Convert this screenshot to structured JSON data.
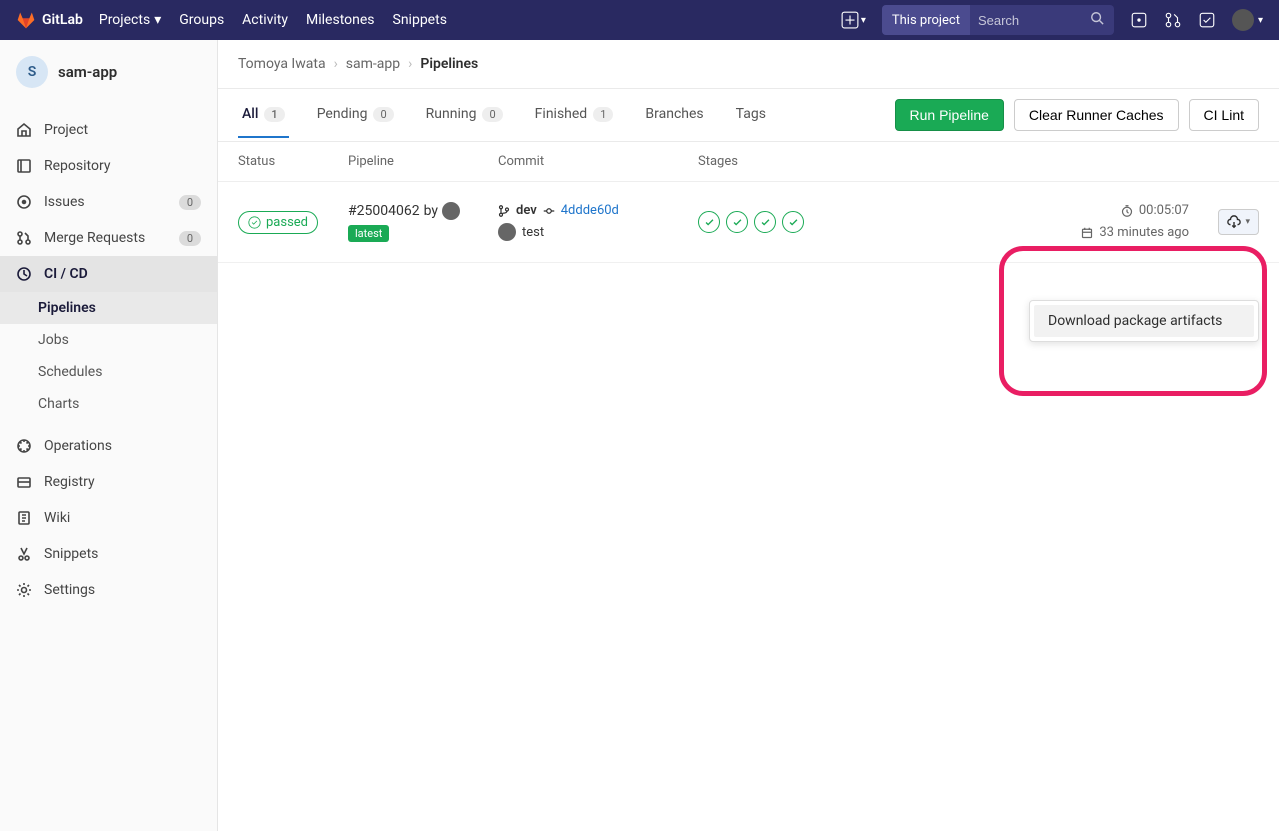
{
  "navbar": {
    "brand": "GitLab",
    "links": [
      "Projects",
      "Groups",
      "Activity",
      "Milestones",
      "Snippets"
    ],
    "search_scope": "This project",
    "search_placeholder": "Search"
  },
  "sidebar": {
    "project_initial": "S",
    "project_name": "sam-app",
    "items": [
      {
        "icon": "home",
        "label": "Project"
      },
      {
        "icon": "repo",
        "label": "Repository"
      },
      {
        "icon": "issues",
        "label": "Issues",
        "count": "0"
      },
      {
        "icon": "merge",
        "label": "Merge Requests",
        "count": "0"
      },
      {
        "icon": "cicd",
        "label": "CI / CD",
        "active": true,
        "sub": [
          {
            "label": "Pipelines",
            "active": true
          },
          {
            "label": "Jobs"
          },
          {
            "label": "Schedules"
          },
          {
            "label": "Charts"
          }
        ]
      },
      {
        "icon": "ops",
        "label": "Operations"
      },
      {
        "icon": "registry",
        "label": "Registry"
      },
      {
        "icon": "wiki",
        "label": "Wiki"
      },
      {
        "icon": "snippets",
        "label": "Snippets"
      },
      {
        "icon": "settings",
        "label": "Settings"
      }
    ]
  },
  "breadcrumbs": [
    "Tomoya Iwata",
    "sam-app",
    "Pipelines"
  ],
  "tabs": [
    {
      "label": "All",
      "count": "1",
      "active": true
    },
    {
      "label": "Pending",
      "count": "0"
    },
    {
      "label": "Running",
      "count": "0"
    },
    {
      "label": "Finished",
      "count": "1"
    },
    {
      "label": "Branches"
    },
    {
      "label": "Tags"
    }
  ],
  "actions": {
    "run": "Run Pipeline",
    "clear": "Clear Runner Caches",
    "lint": "CI Lint"
  },
  "columns": {
    "status": "Status",
    "pipeline": "Pipeline",
    "commit": "Commit",
    "stages": "Stages"
  },
  "pipeline": {
    "status": "passed",
    "id": "#25004062",
    "by": "by",
    "tag": "latest",
    "branch": "dev",
    "sha": "4ddde60d",
    "message": "test",
    "stage_count": 4,
    "duration": "00:05:07",
    "ago": "33 minutes ago"
  },
  "dropdown": {
    "download": "Download package artifacts"
  }
}
